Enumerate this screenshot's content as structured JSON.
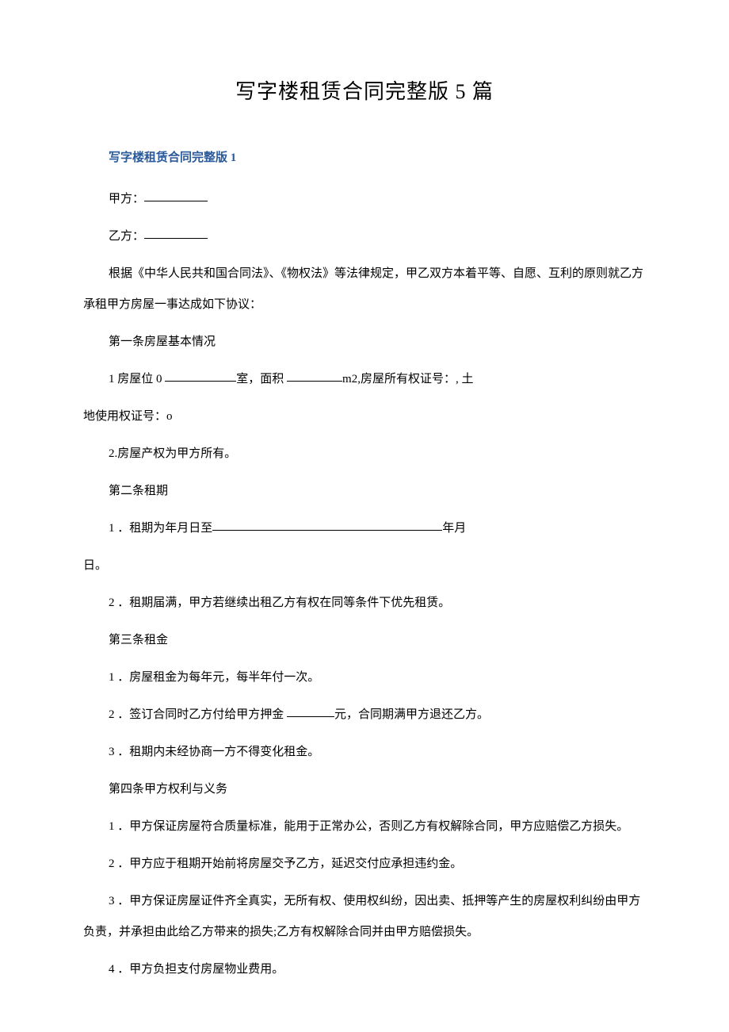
{
  "title": "写字楼租赁合同完整版 5 篇",
  "sectionLabel": "写字楼租赁合同完整版 1",
  "partyA_label": "甲方：",
  "partyB_label": "乙方：",
  "intro": "根据《中华人民共和国合同法》、《物权法》等法律规定，甲乙双方本着平等、自愿、互利的原则就乙方承租甲方房屋一事达成如下协议：",
  "art1_head": "第一条房屋基本情况",
  "art1_1a": "1 房屋位 0 ",
  "art1_1b": "室，面积 ",
  "art1_1c": "m2,房屋所有权证号：, 土",
  "art1_1d": "地使用权证号：o",
  "art1_2": "2.房屋产权为甲方所有。",
  "art2_head": "第二条租期",
  "art2_1a": "1 ．租期为年月日至",
  "art2_1b": "年月",
  "art2_1c": "日。",
  "art2_2": "2 ．租期届满，甲方若继续出租乙方有权在同等条件下优先租赁。",
  "art3_head": "第三条租金",
  "art3_1": "1 ．房屋租金为每年元，每半年付一次。",
  "art3_2a": "2 ．签订合同时乙方付给甲方押金 ",
  "art3_2b": "元，合同期满甲方退还乙方。",
  "art3_3": "3 ．租期内未经协商一方不得变化租金。",
  "art4_head": "第四条甲方权利与义务",
  "art4_1": "1 ．甲方保证房屋符合质量标准，能用于正常办公，否则乙方有权解除合同，甲方应赔偿乙方损失。",
  "art4_2": "2       ．甲方应于租期开始前将房屋交予乙方，延迟交付应承担违约金。",
  "art4_3": "3       ．甲方保证房屋证件齐全真实，无所有权、使用权纠纷，因出卖、抵押等产生的房屋权利纠纷由甲方负责，并承担由此给乙方带来的损失;乙方有权解除合同并由甲方赔偿损失。",
  "art4_4": "4       ．甲方负担支付房屋物业费用。"
}
